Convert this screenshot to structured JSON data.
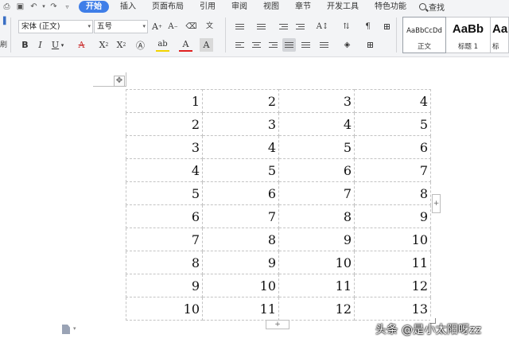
{
  "menubar": {
    "tabs": [
      "开始",
      "插入",
      "页面布局",
      "引用",
      "审阅",
      "视图",
      "章节",
      "开发工具",
      "特色功能"
    ],
    "active_tab": "开始",
    "search_label": "查找"
  },
  "ribbon": {
    "left_clipped_label": "刷",
    "font_name": "宋体 (正文)",
    "font_size": "五号",
    "styles": [
      {
        "preview": "AaBbCcDd",
        "name": "正文"
      },
      {
        "preview": "AaBb",
        "name": "标题 1"
      },
      {
        "preview": "Aa",
        "name": "标"
      }
    ]
  },
  "table": {
    "rows": [
      [
        "1",
        "2",
        "3",
        "4"
      ],
      [
        "2",
        "3",
        "4",
        "5"
      ],
      [
        "3",
        "4",
        "5",
        "6"
      ],
      [
        "4",
        "5",
        "6",
        "7"
      ],
      [
        "5",
        "6",
        "7",
        "8"
      ],
      [
        "6",
        "7",
        "8",
        "9"
      ],
      [
        "7",
        "8",
        "9",
        "10"
      ],
      [
        "8",
        "9",
        "10",
        "11"
      ],
      [
        "9",
        "10",
        "11",
        "12"
      ],
      [
        "10",
        "11",
        "12",
        "13"
      ]
    ],
    "add_button": "+"
  },
  "watermark": "头条 @是小太阳呀zz"
}
